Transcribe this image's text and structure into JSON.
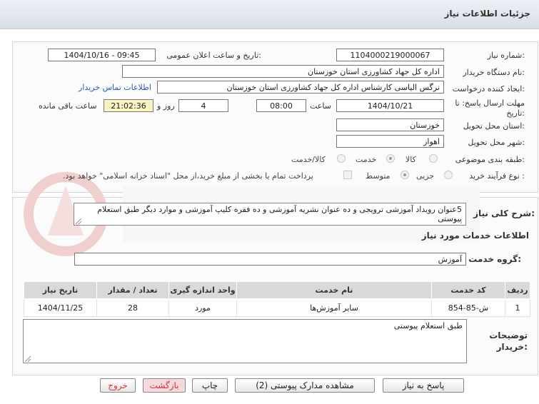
{
  "header": {
    "title": "جزئیات اطلاعات نیاز"
  },
  "form": {
    "need_number_label": "شماره نیاز:",
    "need_number": "1104000219000067",
    "announce_label": "تاریخ و ساعت اعلان عمومی:",
    "announce_value": "1404/10/16 - 09:45",
    "buyer_org_label": "نام دستگاه خریدار:",
    "buyer_org": "اداره کل جهاد کشاورزی استان خوزستان",
    "requester_label": "ایجاد کننده درخواست:",
    "requester": "نرگس الیاسی کارشناس  اداره کل جهاد کشاورزی استان خوزستان",
    "contact_link": "اطلاعات تماس خریدار",
    "deadline_label": "مهلت ارسال پاسخ: تا تاریخ:",
    "deadline_date": "1404/10/21",
    "time_label": "ساعت",
    "deadline_time": "08:00",
    "days_value": "4",
    "days_label": "روز و",
    "remaining_time": "21:02:36",
    "remaining_label": "ساعت باقی مانده",
    "province_label": "استان محل تحویل:",
    "province": "خوزستان",
    "city_label": "شهر محل تحویل:",
    "city": "اهواز",
    "category_label": "طبقه بندی موضوعی:",
    "category_options": [
      "کالا",
      "خدمت",
      "کالا/خدمت"
    ],
    "process_label": "نوع فرآیند خرید :",
    "process_options": [
      "جزیی",
      "متوسط"
    ],
    "payment_note": "پرداخت تمام یا بخشی از مبلغ خرید،از محل \"اسناد خزانه اسلامی\" خواهد بود."
  },
  "description": {
    "label": "شرح کلی نیاز:",
    "text": "5عنوان رویداد آموزشی ترویجی و ده عنوان نشریه آموزشی و ده فقره کلیپ آموزشی  و موارد دیگر طبق استعلام پیوستی"
  },
  "services": {
    "section_title": "اطلاعات خدمات مورد نیاز",
    "group_label": "گروه خدمت:",
    "group_value": "آموزش",
    "columns": [
      "ردیف",
      "کد خدمت",
      "نام خدمت",
      "واحد اندازه گیری",
      "تعداد / مقدار",
      "تاریخ نیاز"
    ],
    "rows": [
      {
        "row": "1",
        "code": "ش-85-854",
        "name": "سایر آموزش‌ها",
        "unit": "مورد",
        "qty": "28",
        "date": "1404/11/25"
      }
    ]
  },
  "buyer_notes": {
    "label": "توضیحات خریدار:",
    "text": "طبق استعلام پیوستی"
  },
  "buttons": {
    "reply": "پاسخ به نیاز",
    "attachments": "مشاهده مدارک پیوستی (2)",
    "print": "چاپ",
    "back": "بازگشت",
    "exit": "خروج"
  }
}
